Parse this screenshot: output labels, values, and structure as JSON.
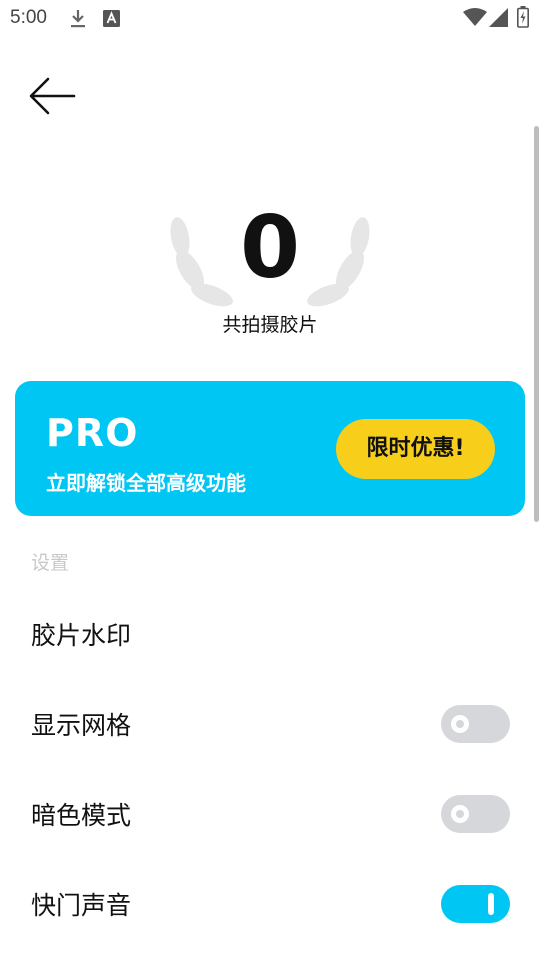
{
  "status_bar": {
    "time": "5:00",
    "icons": [
      "download-icon",
      "text-a-icon",
      "wifi-icon",
      "signal-icon",
      "battery-icon"
    ]
  },
  "header": {
    "back_icon": "arrow-left-icon"
  },
  "stats": {
    "count": "0",
    "label": "共拍摄胶片"
  },
  "pro_card": {
    "title": "PRO",
    "subtitle": "立即解锁全部高级功能",
    "button_label": "限时优惠!",
    "color": "#00c6f4",
    "button_color": "#f7cf1b"
  },
  "settings": {
    "section_label": "设置",
    "items": [
      {
        "label": "胶片水印",
        "has_toggle": false
      },
      {
        "label": "显示网格",
        "has_toggle": true,
        "enabled": false
      },
      {
        "label": "暗色模式",
        "has_toggle": true,
        "enabled": false
      },
      {
        "label": "快门声音",
        "has_toggle": true,
        "enabled": true
      }
    ]
  }
}
